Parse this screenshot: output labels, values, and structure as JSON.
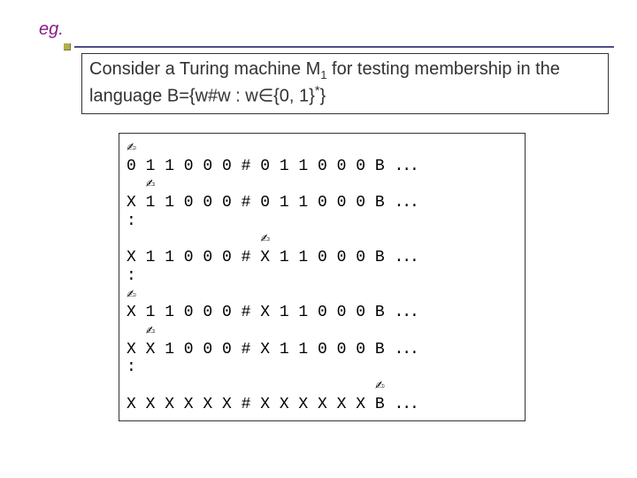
{
  "header": {
    "eg": "eg."
  },
  "problem": {
    "part1": "Consider a Turing machine M",
    "sub1": "1",
    "part2": " for testing membership in the language B={w#w : w",
    "elem": "∈",
    "part3": "{0, 1}",
    "sup": "*",
    "part4": "}"
  },
  "tape": {
    "ell": "...",
    "rows": [
      "✍",
      "0 1 1 0 0 0 # 0 1 1 0 0 0 B ",
      "  ✍",
      "X 1 1 0 0 0 # 0 1 1 0 0 0 B ",
      ":",
      "              ✍",
      "X 1 1 0 0 0 # X 1 1 0 0 0 B ",
      ":",
      "✍",
      "X 1 1 0 0 0 # X 1 1 0 0 0 B ",
      "  ✍",
      "X X 1 0 0 0 # X 1 1 0 0 0 B ",
      ":",
      "                          ✍",
      "X X X X X X # X X X X X X B "
    ]
  }
}
